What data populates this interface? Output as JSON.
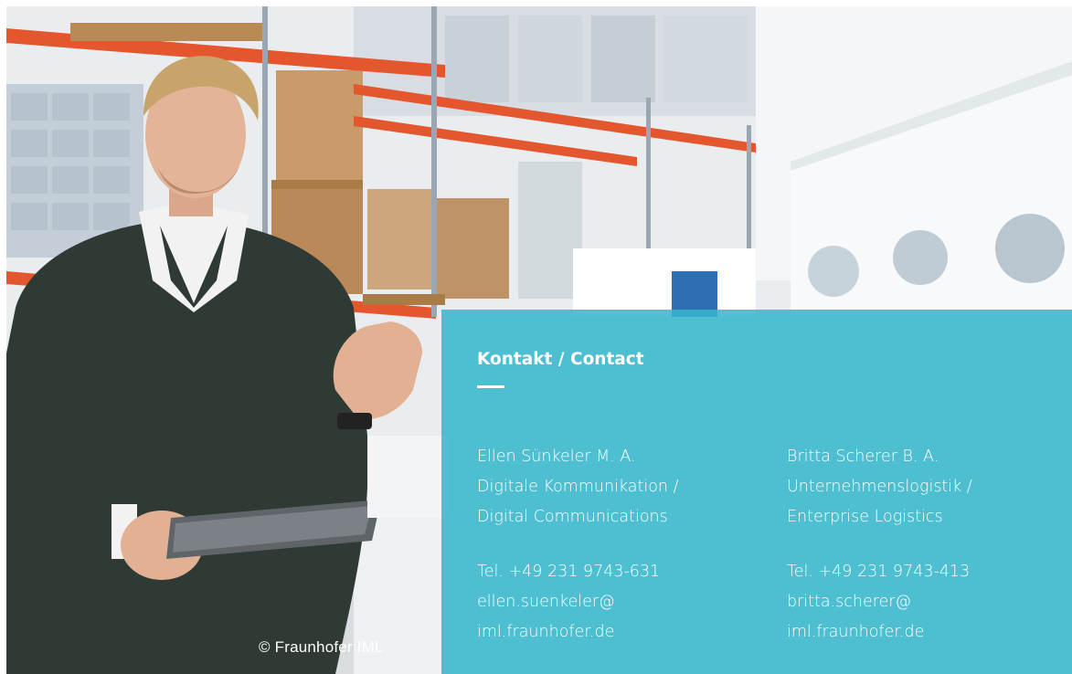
{
  "photo": {
    "credit": "© Fraunhofer IML"
  },
  "contact": {
    "title": "Kontakt / Contact",
    "people": [
      {
        "name": "Ellen Sünkeler M. A.",
        "department_line1": "Digitale Kommunikation /",
        "department_line2": "Digital Communications",
        "phone": "Tel. +49 231 9743-631",
        "email_line1": "ellen.suenkeler@",
        "email_line2": "iml.fraunhofer.de"
      },
      {
        "name": "Britta Scherer B. A.",
        "department_line1": "Unternehmenslogistik /",
        "department_line2": "Enterprise Logistics",
        "phone": "Tel. +49 231 9743-413",
        "email_line1": "britta.scherer@",
        "email_line2": "iml.fraunhofer.de"
      }
    ]
  },
  "colors": {
    "panel": "#34b6cc",
    "text": "#ffffff",
    "shelf_orange": "#e4572e"
  }
}
